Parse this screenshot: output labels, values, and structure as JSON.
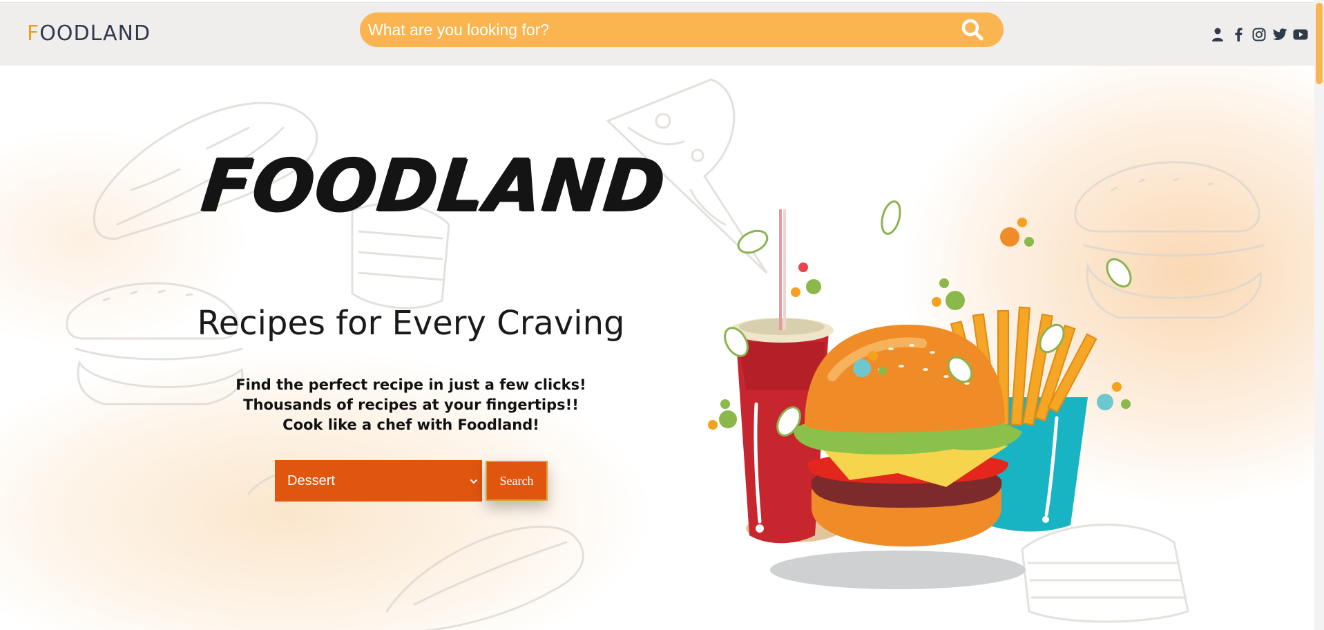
{
  "header": {
    "brand_first_letter": "F",
    "brand_rest": "OODLAND",
    "search": {
      "placeholder": "What are you looking for?"
    }
  },
  "social_icons": [
    "user-icon",
    "facebook-icon",
    "instagram-icon",
    "twitter-icon",
    "youtube-icon"
  ],
  "hero": {
    "title": "FOODLAND",
    "subtitle": "Recipes for Every Craving",
    "taglines": [
      "Find the perfect recipe in just a few clicks!",
      "Thousands of recipes at your fingertips!!",
      "Cook like a chef with Foodland!"
    ],
    "category": {
      "selected": "Dessert"
    },
    "search_button_label": "Search"
  },
  "colors": {
    "accent_orange": "#fbb550",
    "brand_orange": "#f0a012",
    "cta_orange": "#e1560f",
    "navbar_bg": "#efeeed",
    "text_dark": "#2f3a4b"
  }
}
